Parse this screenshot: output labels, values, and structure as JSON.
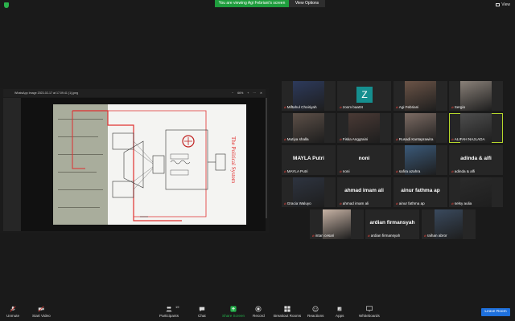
{
  "banner": {
    "text": "You are viewing Agi Febriani's screen",
    "view_options": "View Options"
  },
  "view_label": "View",
  "shared_window": {
    "title": "WhatsApp Image 2023-02-17 at 17.09.41 (1).jpeg",
    "zoom": "66%",
    "document_heading": "The Political System"
  },
  "participants": [
    {
      "name": "Miftahul Choiriyah",
      "type": "photo",
      "color": "#2d3a5c"
    },
    {
      "name": "zoom baa04",
      "type": "avatar",
      "letter": "Z"
    },
    {
      "name": "Agi Febriani",
      "type": "photo",
      "color": "#6b5447"
    },
    {
      "name": "Sergio",
      "type": "photo",
      "color": "#8a8179"
    },
    {
      "name": "Mutiya shalla",
      "type": "photo",
      "color": "#5d5048"
    },
    {
      "name": "Fiska Anggraini",
      "type": "photo",
      "color": "#4a3a35"
    },
    {
      "name": "Rusadi Kantaprawira",
      "type": "photo",
      "color": "#7c6b63"
    },
    {
      "name": "ALIFAH NAJLADA",
      "type": "photo",
      "color": "#4e4e4e",
      "highlight": true
    },
    {
      "name": "MAYLA Putri",
      "type": "name",
      "label": "MAYLA Putri"
    },
    {
      "name": "noni",
      "type": "name",
      "label": "noni"
    },
    {
      "name": "safira azahra",
      "type": "photo",
      "color": "#3b5a7a"
    },
    {
      "name": "adinda & alfi",
      "type": "name",
      "label": "adinda & alfi"
    },
    {
      "name": "Gracia Waluyo",
      "type": "photo",
      "color": "#2e3440"
    },
    {
      "name": "ahmad imam ali",
      "type": "name",
      "label": "ahmad imam ali"
    },
    {
      "name": "ainur fathma ap",
      "type": "name",
      "label": "ainur fathma ap"
    },
    {
      "name": "selsy aulia",
      "type": "photo",
      "color": "#2b2b2b"
    },
    {
      "name": "intan cesari",
      "type": "photo",
      "color": "#c7b3a5"
    },
    {
      "name": "ardian firmansyah",
      "type": "name",
      "label": "ardian firmansyah"
    },
    {
      "name": "raihan abror",
      "type": "photo",
      "color": "#3a4a5e"
    }
  ],
  "toolbar": {
    "unmute": "Unmute",
    "start_video": "Start Video",
    "participants": "Participants",
    "participants_count": "19",
    "chat": "Chat",
    "share_screen": "Share Screen",
    "record": "Record",
    "breakout_rooms": "Breakout Rooms",
    "reactions": "Reactions",
    "apps": "Apps",
    "whiteboards": "Whiteboards",
    "leave": "Leave Room"
  },
  "colors": {
    "accent_green": "#1f9d3d",
    "leave_blue": "#1e70dc",
    "mic_muted": "#e0463e",
    "active_speaker": "#b6d72c",
    "diagram_red": "#e03030"
  }
}
